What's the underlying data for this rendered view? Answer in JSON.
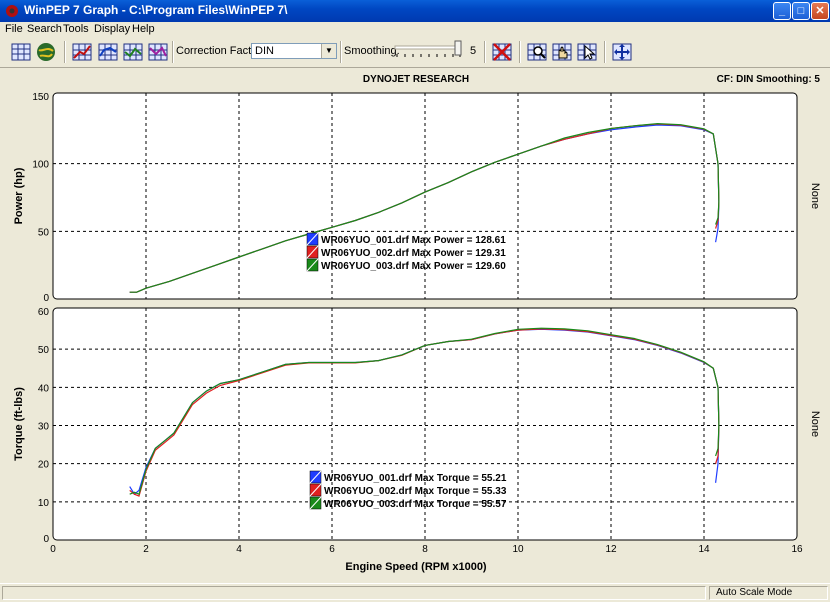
{
  "window": {
    "title": "WinPEP 7    Graph - C:\\Program Files\\WinPEP 7\\",
    "minimize": "_",
    "maximize": "□",
    "close": "✕"
  },
  "menu": [
    "File",
    "Search",
    "Tools",
    "Display",
    "Help"
  ],
  "toolbar": {
    "correction_label": "Correction Factor:",
    "correction_value": "DIN",
    "smoothing_label": "Smoothing:",
    "smoothing_value": "5"
  },
  "chart_header": {
    "title": "DYNOJET RESEARCH",
    "info": "CF: DIN  Smoothing: 5"
  },
  "status": {
    "text": "Auto Scale Mode"
  },
  "colors": {
    "run1": "#1e3cff",
    "run2": "#e02020",
    "run3": "#1a8a1a"
  },
  "chart_data": [
    {
      "type": "line",
      "ylabel": "Power (hp)",
      "right_label": "None",
      "xlabel": "Engine Speed (RPM x1000)",
      "xlim": [
        0,
        16
      ],
      "ylim": [
        0,
        150
      ],
      "xticks": [
        0,
        2,
        4,
        6,
        8,
        10,
        12,
        14,
        16
      ],
      "yticks": [
        0,
        50,
        100,
        150
      ],
      "grid": true,
      "legend": "center-left",
      "series": [
        {
          "name": "WR06YUO_001.drf Max Power = 128.61",
          "color": "#1e3cff",
          "x": [
            1.65,
            1.8,
            2,
            2.5,
            3,
            3.5,
            4,
            4.5,
            5,
            5.5,
            6,
            6.5,
            7,
            7.5,
            8,
            8.5,
            9,
            9.5,
            10,
            10.5,
            11,
            11.5,
            12,
            12.5,
            13,
            13.5,
            14,
            14.2,
            14.3,
            14.32,
            14.3,
            14.25
          ],
          "y": [
            5,
            5,
            8,
            13,
            19,
            25,
            31,
            37,
            43,
            48,
            53,
            58,
            64,
            71,
            79,
            86,
            94,
            101,
            107,
            113,
            118,
            122,
            125,
            127,
            128.6,
            128,
            125,
            122,
            100,
            70,
            52,
            42
          ]
        },
        {
          "name": "WR06YUO_002.drf Max Power = 129.31",
          "color": "#e02020",
          "x": [
            1.65,
            1.8,
            2,
            2.5,
            3,
            3.5,
            4,
            4.5,
            5,
            5.5,
            6,
            6.5,
            7,
            7.5,
            8,
            8.5,
            9,
            9.5,
            10,
            10.5,
            11,
            11.5,
            12,
            12.5,
            13,
            13.5,
            14,
            14.2,
            14.3,
            14.32,
            14.3,
            14.25
          ],
          "y": [
            5,
            5,
            8,
            13,
            19,
            25,
            31,
            37,
            43,
            48,
            53,
            58,
            64,
            71,
            79,
            86,
            94,
            101,
            107,
            113,
            118,
            122,
            126,
            128,
            129.3,
            128.5,
            125.5,
            122,
            100,
            72,
            58,
            52
          ]
        },
        {
          "name": "WR06YUO_003.drf Max Power = 129.60",
          "color": "#1a8a1a",
          "x": [
            1.65,
            1.8,
            2,
            2.5,
            3,
            3.5,
            4,
            4.5,
            5,
            5.5,
            6,
            6.5,
            7,
            7.5,
            8,
            8.5,
            9,
            9.5,
            10,
            10.5,
            11,
            11.5,
            12,
            12.5,
            13,
            13.5,
            14,
            14.2,
            14.3,
            14.32,
            14.3,
            14.25
          ],
          "y": [
            5,
            5,
            8,
            13,
            19,
            25,
            31,
            37,
            43,
            48,
            53,
            58,
            64,
            71,
            79,
            86,
            94,
            101,
            107,
            113,
            119,
            123,
            126,
            128,
            129.6,
            128.8,
            125.8,
            122,
            100,
            72,
            60,
            55
          ]
        }
      ]
    },
    {
      "type": "line",
      "ylabel": "Torque (ft-lbs)",
      "right_label": "None",
      "xlabel": "Engine Speed (RPM x1000)",
      "xlim": [
        0,
        16
      ],
      "ylim": [
        0,
        60
      ],
      "xticks": [
        0,
        2,
        4,
        6,
        8,
        10,
        12,
        14,
        16
      ],
      "yticks": [
        0,
        10,
        20,
        30,
        40,
        50,
        60
      ],
      "grid": true,
      "legend": "bottom-center",
      "series": [
        {
          "name": "WR06YUO_001.drf Max Torque = 55.21",
          "color": "#1e3cff",
          "x": [
            1.65,
            1.75,
            1.85,
            2,
            2.2,
            2.4,
            2.6,
            2.8,
            3,
            3.3,
            3.6,
            4,
            4.5,
            5,
            5.5,
            6,
            6.5,
            7,
            7.5,
            8,
            8.5,
            9,
            9.5,
            10,
            10.5,
            11,
            11.5,
            12,
            12.5,
            13,
            13.5,
            14,
            14.2,
            14.3,
            14.32,
            14.3,
            14.25
          ],
          "y": [
            14,
            12,
            13,
            19,
            24,
            26,
            28,
            32,
            36,
            39,
            41,
            42,
            44,
            46,
            46.5,
            46.5,
            46.5,
            47,
            48.5,
            51,
            52,
            52.5,
            54,
            55,
            55.2,
            55,
            54.5,
            53.5,
            52.5,
            51,
            49,
            46.5,
            45,
            40,
            30,
            20,
            15
          ]
        },
        {
          "name": "WR06YUO_002.drf Max Torque = 55.33",
          "color": "#e02020",
          "x": [
            1.65,
            1.75,
            1.85,
            2,
            2.2,
            2.4,
            2.6,
            2.8,
            3,
            3.3,
            3.6,
            4,
            4.5,
            5,
            5.5,
            6,
            6.5,
            7,
            7.5,
            8,
            8.5,
            9,
            9.5,
            10,
            10.5,
            11,
            11.5,
            12,
            12.5,
            13,
            13.5,
            14,
            14.2,
            14.3,
            14.32,
            14.3,
            14.25
          ],
          "y": [
            13,
            12,
            11.5,
            18,
            23.5,
            25.5,
            27.5,
            31.5,
            35.5,
            38.5,
            40.5,
            41.8,
            43.8,
            45.8,
            46.4,
            46.4,
            46.4,
            47,
            48.4,
            51,
            52,
            52.5,
            54,
            55,
            55.3,
            55.1,
            54.6,
            53.6,
            52.6,
            51.1,
            49.1,
            46.6,
            45,
            40,
            30,
            22,
            20
          ]
        },
        {
          "name": "WR06YUO_003.drf Max Torque = 55.57",
          "color": "#1a8a1a",
          "x": [
            1.65,
            1.75,
            1.85,
            2,
            2.2,
            2.4,
            2.6,
            2.8,
            3,
            3.3,
            3.6,
            4,
            4.5,
            5,
            5.5,
            6,
            6.5,
            7,
            7.5,
            8,
            8.5,
            9,
            9.5,
            10,
            10.5,
            11,
            11.5,
            12,
            12.5,
            13,
            13.5,
            14,
            14.2,
            14.3,
            14.32,
            14.3,
            14.25
          ],
          "y": [
            12,
            12.5,
            12,
            18.5,
            24,
            26,
            28,
            32,
            36,
            39,
            41,
            42,
            44,
            46,
            46.5,
            46.5,
            46.5,
            47,
            48.5,
            51,
            52,
            52.6,
            54.1,
            55.2,
            55.5,
            55.3,
            54.8,
            53.8,
            52.8,
            51.2,
            49.2,
            46.7,
            45,
            40,
            30,
            24,
            22
          ]
        }
      ]
    }
  ]
}
